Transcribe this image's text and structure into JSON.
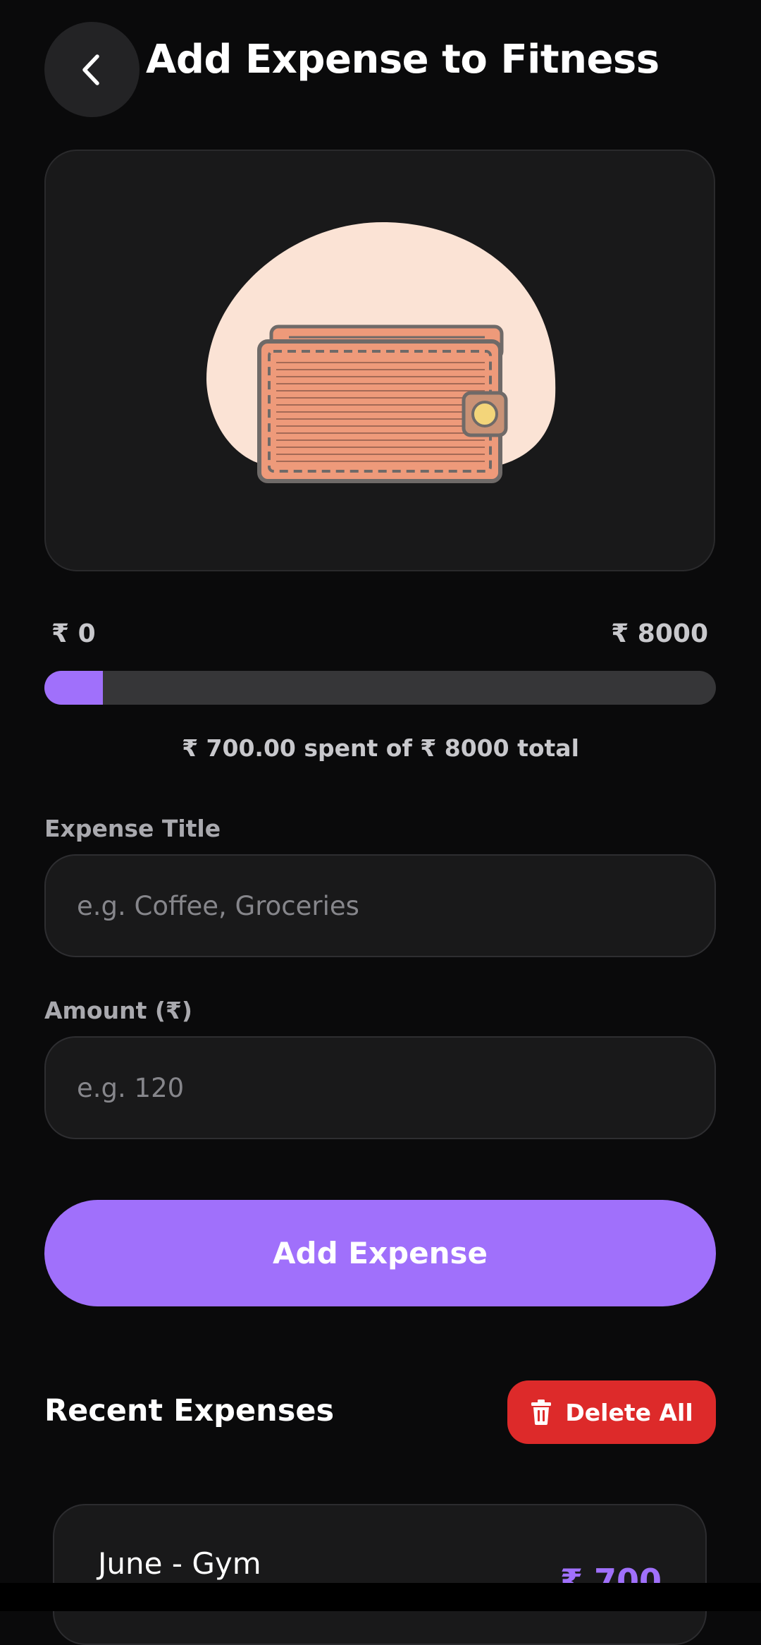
{
  "header": {
    "back_icon": "chevron-left-icon",
    "title": "Add Expense to Fitness"
  },
  "illustration": {
    "icon": "wallet-icon",
    "blob_color": "#fbe3d5",
    "wallet_color": "#ee9a7a"
  },
  "budget": {
    "min_label": "₹ 0",
    "max_label": "₹ 8000",
    "spent": 700,
    "total": 8000,
    "progress_fraction": 0.0875,
    "summary": "₹ 700.00 spent of ₹ 8000 total"
  },
  "form": {
    "title_label": "Expense Title",
    "title_placeholder": "e.g. Coffee, Groceries",
    "title_value": "",
    "amount_label": "Amount (₹)",
    "amount_placeholder": "e.g. 120",
    "amount_value": "",
    "submit_label": "Add Expense"
  },
  "recent": {
    "title": "Recent Expenses",
    "delete_all_label": "Delete All",
    "delete_icon": "trash-icon",
    "items": [
      {
        "name": "June - Gym",
        "amount": "₹ 700"
      }
    ]
  },
  "colors": {
    "background": "#0a0a0b",
    "card": "#19191a",
    "accent": "#a070fb",
    "danger": "#dd2a2a",
    "muted_text": "#c8c8cc"
  }
}
